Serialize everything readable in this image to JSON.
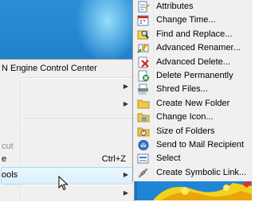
{
  "context_menu": {
    "items": [
      {
        "label": "N Engine Control Center",
        "shortcut": "",
        "submenu": false,
        "disabled": false
      },
      {
        "label": "",
        "shortcut": "",
        "submenu": true,
        "disabled": false
      },
      {
        "label": "",
        "shortcut": "",
        "submenu": true,
        "disabled": false
      },
      {
        "label": "cut",
        "shortcut": "",
        "submenu": false,
        "disabled": true
      },
      {
        "label": "e",
        "shortcut": "Ctrl+Z",
        "submenu": false,
        "disabled": false
      },
      {
        "label": "ools",
        "shortcut": "",
        "submenu": true,
        "disabled": false,
        "highlighted": true
      },
      {
        "label": "",
        "shortcut": "",
        "submenu": true,
        "disabled": false
      }
    ],
    "submenu_arrow": "▶"
  },
  "submenu": {
    "items": [
      {
        "label": "Attributes",
        "icon": "attributes-icon"
      },
      {
        "label": "Change Time...",
        "icon": "calendar-icon"
      },
      {
        "label": "Find and Replace...",
        "icon": "find-replace-icon"
      },
      {
        "label": "Advanced Renamer...",
        "icon": "renamer-icon"
      },
      {
        "label": "Advanced Delete...",
        "icon": "delete-icon"
      },
      {
        "label": "Delete Permanently",
        "icon": "delete-permanently-icon"
      },
      {
        "label": "Shred Files...",
        "icon": "shredder-icon"
      },
      {
        "label": "Create New Folder",
        "icon": "new-folder-icon"
      },
      {
        "label": "Change Icon...",
        "icon": "folder-icon"
      },
      {
        "label": "Size of Folders",
        "icon": "folder-size-icon"
      },
      {
        "label": "Send to Mail Recipient",
        "icon": "mail-icon"
      },
      {
        "label": "Select",
        "icon": "select-icon"
      },
      {
        "label": "Create Symbolic Link...",
        "icon": "link-icon"
      }
    ]
  },
  "colors": {
    "desktop": "#1f7fcc",
    "menu_bg": "#f0f0f0",
    "highlight_border": "#a8d8f8"
  }
}
